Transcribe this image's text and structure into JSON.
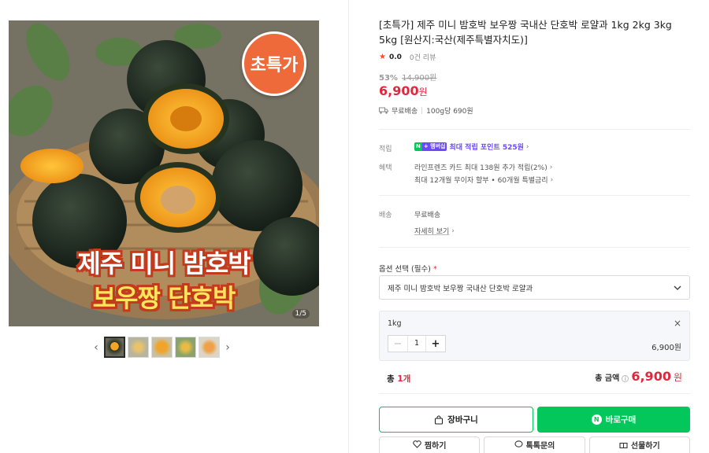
{
  "gallery": {
    "badge": "초특가",
    "image_title_line1": "제주 미니 밤호박",
    "image_title_line2": "보우짱 단호박",
    "counter": "1/5",
    "prev_arrow": "‹",
    "next_arrow": "›",
    "thumbnail_count": 5
  },
  "product": {
    "title": "[초특가] 제주 미니 밤호박 보우짱 국내산 단호박 로얄과 1kg 2kg 3kg 5kg [원산지:국산(제주특별자치도)]",
    "rating": "0.0",
    "reviews": "0건 리뷰",
    "discount_percent": "53%",
    "original_price": "14,900원",
    "price": "6,900",
    "price_unit": "원",
    "shipping_free": "무료배송",
    "unit_price": "100g당 690원"
  },
  "benefits": {
    "points_label": "적립",
    "npay_n": "N",
    "npay_mem": "+ 멤버십",
    "points_text": "최대 적립 포인트 525원",
    "benefit_label": "혜택",
    "benefit_line1": "라인프렌즈 카드 최대 138원 추가 적립(2%)",
    "benefit_line2": "최대 12개월 무이자 할부 • 60개월 특별금리"
  },
  "delivery": {
    "label": "배송",
    "value": "무료배송",
    "detail_link": "자세히 보기"
  },
  "options": {
    "label": "옵션 선택 (필수)",
    "required_mark": "*",
    "selected_value": "제주 미니 밤호박 보우짱 국내산 단호박 로얄과"
  },
  "chosen": {
    "name": "1kg",
    "close": "×",
    "minus": "−",
    "quantity": "1",
    "plus": "+",
    "price": "6,900원"
  },
  "total": {
    "count_prefix": "총 ",
    "count": "1개",
    "amount_label": "총 금액",
    "info": "i",
    "amount": "6,900",
    "amount_unit": "원"
  },
  "buttons": {
    "cart": "장바구니",
    "buy": "바로구매",
    "npay_badge": "N",
    "wish": "찜하기",
    "talk": "톡톡문의",
    "gift": "선물하기"
  },
  "colors": {
    "accent_green": "#03c75a",
    "price_red": "#e0273b",
    "points_purple": "#6b48ff",
    "badge_orange": "#ef6a3a"
  }
}
